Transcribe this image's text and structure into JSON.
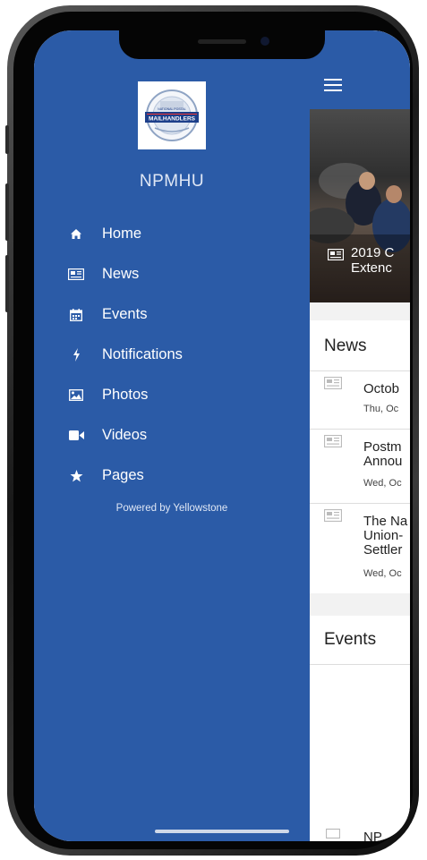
{
  "drawer": {
    "brand": "NPMHU",
    "logo_text": "NATIONAL POSTAL MAILHANDLERS",
    "menu": [
      {
        "label": "Home",
        "icon": "home-icon"
      },
      {
        "label": "News",
        "icon": "newspaper-icon"
      },
      {
        "label": "Events",
        "icon": "calendar-icon"
      },
      {
        "label": "Notifications",
        "icon": "bolt-icon"
      },
      {
        "label": "Photos",
        "icon": "image-icon"
      },
      {
        "label": "Videos",
        "icon": "video-icon"
      },
      {
        "label": "Pages",
        "icon": "star-icon"
      }
    ],
    "powered_by": "Powered by Yellowstone"
  },
  "content": {
    "hero_caption_line1": "2019 C",
    "hero_caption_line2": "Extenc",
    "news_title": "News",
    "news_items": [
      {
        "title": "Octob",
        "date": "Thu, Oc"
      },
      {
        "title": "Postm\nAnnou",
        "date": "Wed, Oc"
      },
      {
        "title": "The Na\nUnion-\nSettler",
        "date": "Wed, Oc"
      }
    ],
    "events_title": "Events",
    "bottom_item": "NP"
  },
  "colors": {
    "primary": "#2b5ba7",
    "background": "#f2f2f2"
  }
}
